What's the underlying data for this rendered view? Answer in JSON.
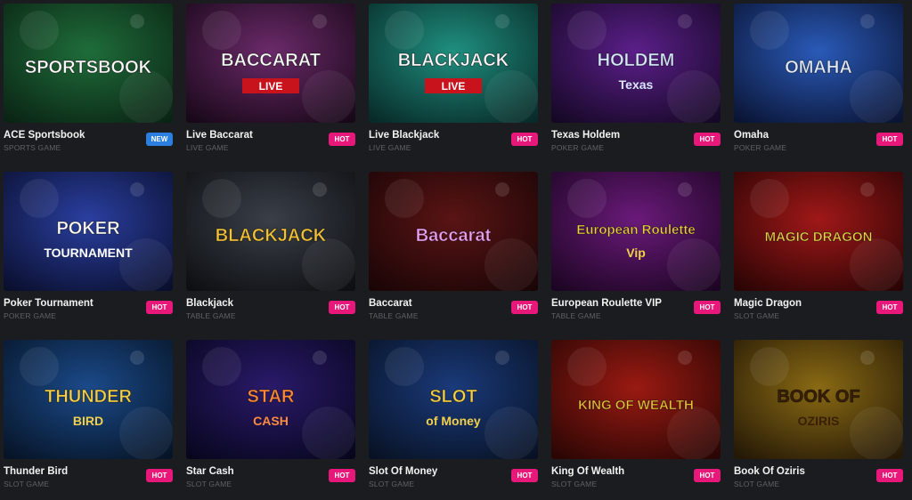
{
  "games": [
    {
      "name": "ACE Sportsbook",
      "category": "SPORTS GAME",
      "badge": "NEW",
      "thumb_title": "SPORTSBOOK",
      "thumb_sub": "",
      "colors": [
        "#1f6d3a",
        "#0a2414"
      ],
      "accent": "#ffffff"
    },
    {
      "name": "Live Baccarat",
      "category": "LIVE GAME",
      "badge": "HOT",
      "thumb_title": "BACCARAT",
      "thumb_sub": "LIVE",
      "colors": [
        "#6b2a6a",
        "#180818"
      ],
      "accent": "#ffffff"
    },
    {
      "name": "Live Blackjack",
      "category": "LIVE GAME",
      "badge": "HOT",
      "thumb_title": "BLACKJACK",
      "thumb_sub": "LIVE",
      "colors": [
        "#1f8f7f",
        "#082a28"
      ],
      "accent": "#ffffff"
    },
    {
      "name": "Texas Holdem",
      "category": "POKER GAME",
      "badge": "HOT",
      "thumb_title": "HOLDEM",
      "thumb_sub": "Texas",
      "colors": [
        "#5b1f8a",
        "#150824"
      ],
      "accent": "#d9e6ff"
    },
    {
      "name": "Omaha",
      "category": "POKER GAME",
      "badge": "HOT",
      "thumb_title": "OMAHA",
      "thumb_sub": "",
      "colors": [
        "#2a5ab8",
        "#0a1434"
      ],
      "accent": "#dfeaff"
    },
    {
      "name": "Poker Tournament",
      "category": "POKER GAME",
      "badge": "HOT",
      "thumb_title": "POKER",
      "thumb_sub": "TOURNAMENT",
      "colors": [
        "#2a3fa0",
        "#0a0f2e"
      ],
      "accent": "#ffffff"
    },
    {
      "name": "Blackjack",
      "category": "TABLE GAME",
      "badge": "HOT",
      "thumb_title": "BLACKJACK",
      "thumb_sub": "",
      "colors": [
        "#3a3f48",
        "#0d0f12"
      ],
      "accent": "#f3c33c"
    },
    {
      "name": "Baccarat",
      "category": "TABLE GAME",
      "badge": "HOT",
      "thumb_title": "Baccarat",
      "thumb_sub": "",
      "colors": [
        "#5a1414",
        "#1a0506"
      ],
      "accent": "#f0a0f0"
    },
    {
      "name": "European Roulette VIP",
      "category": "TABLE GAME",
      "badge": "HOT",
      "thumb_title": "European Roulette",
      "thumb_sub": "Vip",
      "colors": [
        "#6a1a7a",
        "#1c0522"
      ],
      "accent": "#f3d04c"
    },
    {
      "name": "Magic Dragon",
      "category": "SLOT GAME",
      "badge": "HOT",
      "thumb_title": "MAGIC DRAGON",
      "thumb_sub": "",
      "colors": [
        "#a01818",
        "#2a0404"
      ],
      "accent": "#f3d04c"
    },
    {
      "name": "Thunder Bird",
      "category": "SLOT GAME",
      "badge": "HOT",
      "thumb_title": "THUNDER",
      "thumb_sub": "BIRD",
      "colors": [
        "#1b4a8a",
        "#061426"
      ],
      "accent": "#f3d04c"
    },
    {
      "name": "Star Cash",
      "category": "SLOT GAME",
      "badge": "HOT",
      "thumb_title": "STAR",
      "thumb_sub": "CASH",
      "colors": [
        "#2a1a6a",
        "#08061e"
      ],
      "accent": "#ff8a3c"
    },
    {
      "name": "Slot Of Money",
      "category": "SLOT GAME",
      "badge": "HOT",
      "thumb_title": "SLOT",
      "thumb_sub": "of Money",
      "colors": [
        "#1a3a7a",
        "#081224"
      ],
      "accent": "#f3d04c"
    },
    {
      "name": "King Of Wealth",
      "category": "SLOT GAME",
      "badge": "HOT",
      "thumb_title": "KING OF WEALTH",
      "thumb_sub": "",
      "colors": [
        "#9a1a12",
        "#2a0604"
      ],
      "accent": "#f3c33c"
    },
    {
      "name": "Book Of Oziris",
      "category": "SLOT GAME",
      "badge": "HOT",
      "thumb_title": "BOOK OF",
      "thumb_sub": "OZIRIS",
      "colors": [
        "#8a6a14",
        "#241806"
      ],
      "accent": "#3a2004"
    }
  ]
}
